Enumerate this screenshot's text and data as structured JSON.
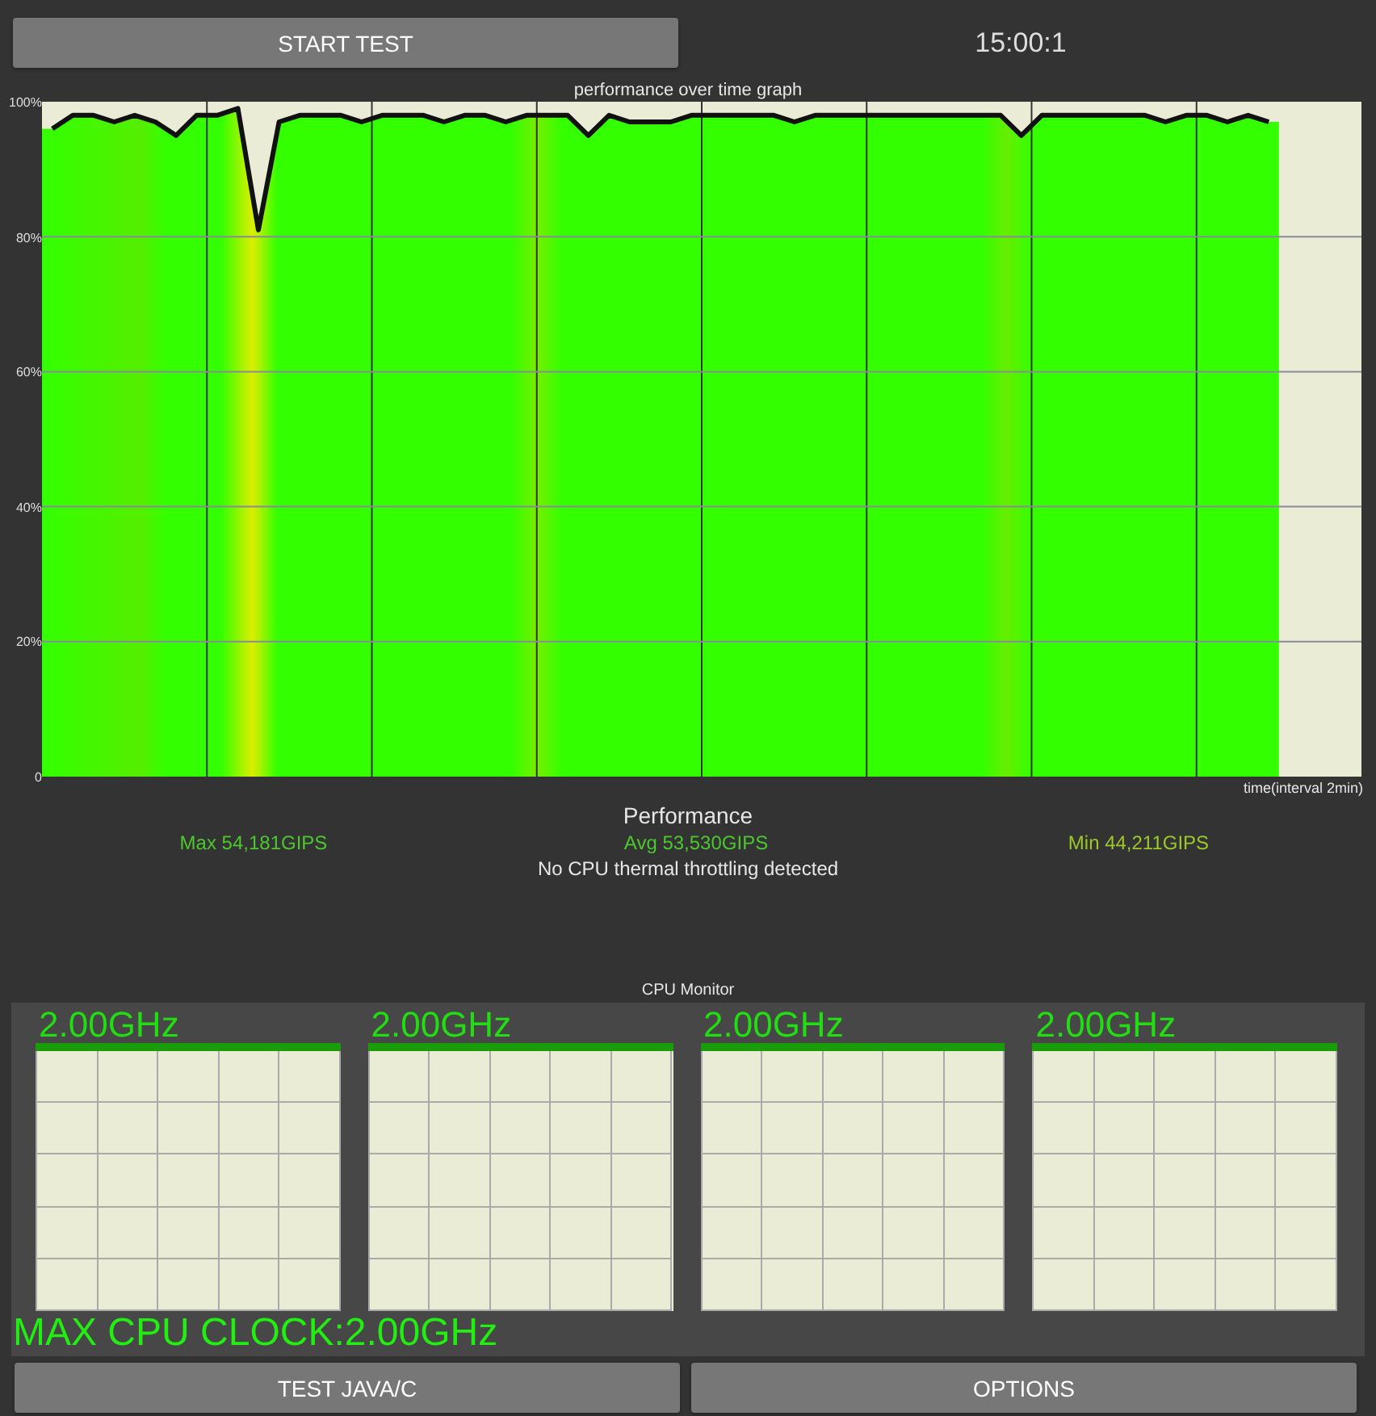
{
  "top_bar": {
    "start_button": "START TEST",
    "timer": "15:00:1"
  },
  "graph": {
    "chart_data": {
      "type": "line",
      "title": "performance over time graph",
      "xlabel": "time(interval 2min)",
      "ylim": [
        0,
        100
      ],
      "grid": true,
      "yticks": [
        {
          "value": 100,
          "label": "100%"
        },
        {
          "value": 80,
          "label": "80%"
        },
        {
          "value": 60,
          "label": "60%"
        },
        {
          "value": 40,
          "label": "40%"
        },
        {
          "value": 20,
          "label": "20%"
        },
        {
          "value": 0,
          "label": "0"
        }
      ],
      "categories": [
        null,
        null,
        null,
        null,
        null,
        null,
        null,
        null,
        null,
        null,
        null,
        null,
        null,
        null,
        null,
        null,
        null,
        null,
        null,
        null,
        null,
        null,
        null,
        null,
        null,
        null,
        null,
        null,
        null,
        null,
        null,
        null,
        null,
        null,
        null,
        null,
        null,
        null,
        null,
        null,
        null,
        null,
        null,
        null,
        null,
        null,
        null,
        null,
        null,
        null,
        null,
        null,
        null,
        null,
        null,
        null,
        null,
        null,
        null,
        null
      ],
      "series": [
        {
          "color": "#111111",
          "values": [
            96,
            98,
            98,
            97,
            98,
            97,
            95,
            98,
            98,
            99,
            81,
            97,
            98,
            98,
            98,
            97,
            98,
            98,
            98,
            97,
            98,
            98,
            97,
            98,
            98,
            98,
            95,
            98,
            97,
            97,
            97,
            98,
            98,
            98,
            98,
            98,
            97,
            98,
            98,
            98,
            98,
            98,
            98,
            98,
            98,
            98,
            98,
            95,
            98,
            98,
            98,
            98,
            98,
            98,
            97,
            98,
            98,
            97,
            98,
            97
          ]
        }
      ]
    }
  },
  "performance": {
    "title": "Performance",
    "max": "Max 54,181GIPS",
    "avg": "Avg 53,530GIPS",
    "min": "Min 44,211GIPS",
    "message": "No CPU thermal throttling detected"
  },
  "cpu_monitor": {
    "title": "CPU Monitor",
    "cores": [
      {
        "frequency": "2.00GHz",
        "level": 1
      },
      {
        "frequency": "2.00GHz",
        "level": 1
      },
      {
        "frequency": "2.00GHz",
        "level": 1
      },
      {
        "frequency": "2.00GHz",
        "level": 1
      }
    ],
    "max_clock": "MAX CPU CLOCK:2.00GHz"
  },
  "bottom_buttons": [
    "TEST JAVA/C",
    "OPTIONS"
  ]
}
